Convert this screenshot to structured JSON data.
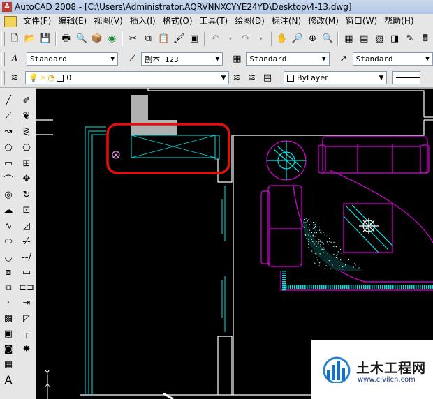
{
  "window": {
    "title": "AutoCAD 2008 - [C:\\Users\\Administrator.AQRVNNXCYYE24YD\\Desktop\\4-13.dwg]",
    "app_icon": "autocad-icon"
  },
  "menu": [
    "文件(F)",
    "编辑(E)",
    "视图(V)",
    "插入(I)",
    "格式(O)",
    "工具(T)",
    "绘图(D)",
    "标注(N)",
    "修改(M)",
    "窗口(W)",
    "帮助(H)"
  ],
  "styles": {
    "text_style": "Standard",
    "dim_style": "副本 123",
    "table_style": "Standard",
    "mleader_style": "Standard"
  },
  "layers": {
    "current": "0",
    "color": "ByLayer"
  },
  "canvas": {
    "ucs_y_label": "Y"
  },
  "watermark": {
    "cn": "土木工程网",
    "url": "www.civilcn.com"
  },
  "colors": {
    "canvas_bg": "#000000",
    "wall": "#00e5e5",
    "furniture": "#e000e0",
    "highlight": "#e01010",
    "white_line": "#ffffff",
    "gray_block": "#b0b0b0"
  }
}
